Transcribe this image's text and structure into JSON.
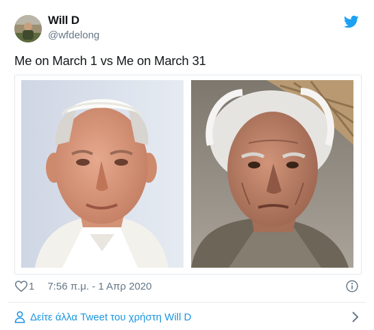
{
  "author": {
    "name": "Will D",
    "handle": "@wfdelong"
  },
  "tweet": {
    "text": "Me on March 1 vs Me on March 31",
    "like_count": "1",
    "timestamp": "7:56 π.μ. - 1 Απρ 2020"
  },
  "footer": {
    "more_tweets_label": "Δείτε άλλα Tweet του χρήστη Will D"
  },
  "colors": {
    "brand": "#1da1f2",
    "link": "#1b95e0",
    "secondary_text": "#657786"
  },
  "icons": {
    "logo": "twitter-bird-icon",
    "like": "heart-icon",
    "info": "info-icon",
    "profile": "person-icon",
    "more": "chevron-right-icon"
  }
}
